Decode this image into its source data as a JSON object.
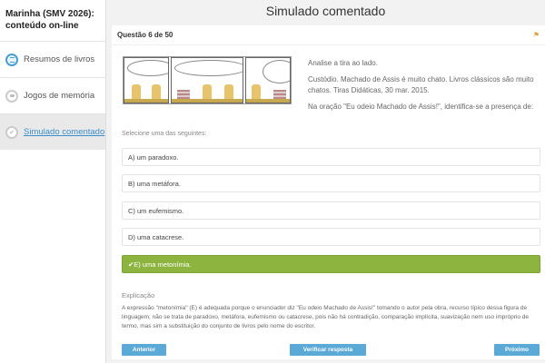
{
  "sidebar": {
    "course_title": "Marinha (SMV 2026): conteúdo on-line",
    "items": [
      {
        "label": "Resumos de livros"
      },
      {
        "label": "Jogos de memória"
      },
      {
        "label": "Simulado comentado"
      }
    ]
  },
  "header": {
    "title": "Simulado comentado"
  },
  "question": {
    "number": "Questão 6 de 50",
    "paragraphs": [
      "Analise a tira ao lado.",
      "Custódio. Machado de Assis é muito chato. Livros clássicos são muito chatos. Tiras Didáticas, 30 mar. 2015.",
      "Na oração \"Eu odeio Machado de Assis!\", identifica-se a presença de:"
    ],
    "prompt": "Selecione uma das seguintes:",
    "options": [
      {
        "label": "A) um paradoxo."
      },
      {
        "label": "B) uma metáfora."
      },
      {
        "label": "C) um eufemismo."
      },
      {
        "label": "D) uma catacrese."
      },
      {
        "label": "✔E) uma metonímia."
      }
    ],
    "explanation_title": "Explicação",
    "explanation": "A expressão \"metonímia\" (E) é adequada porque o enunciador diz \"Eu odeio Machado de Assis!\" tomando o autor pela obra, recurso típico dessa figura de linguagem; não se trata de paradoxo, metáfora, eufemismo ou catacrese, pois não há contradição, comparação implícita, suavização nem uso impróprio de termo, mas sim a substituição do conjunto de livros pelo nome do escritor."
  },
  "buttons": {
    "previous": "Anterior",
    "verify": "Verificar resposta",
    "next": "Próximo"
  },
  "colors": {
    "accent": "#5aa9d6",
    "correct": "#8cb43f",
    "link": "#3a8fc9"
  }
}
